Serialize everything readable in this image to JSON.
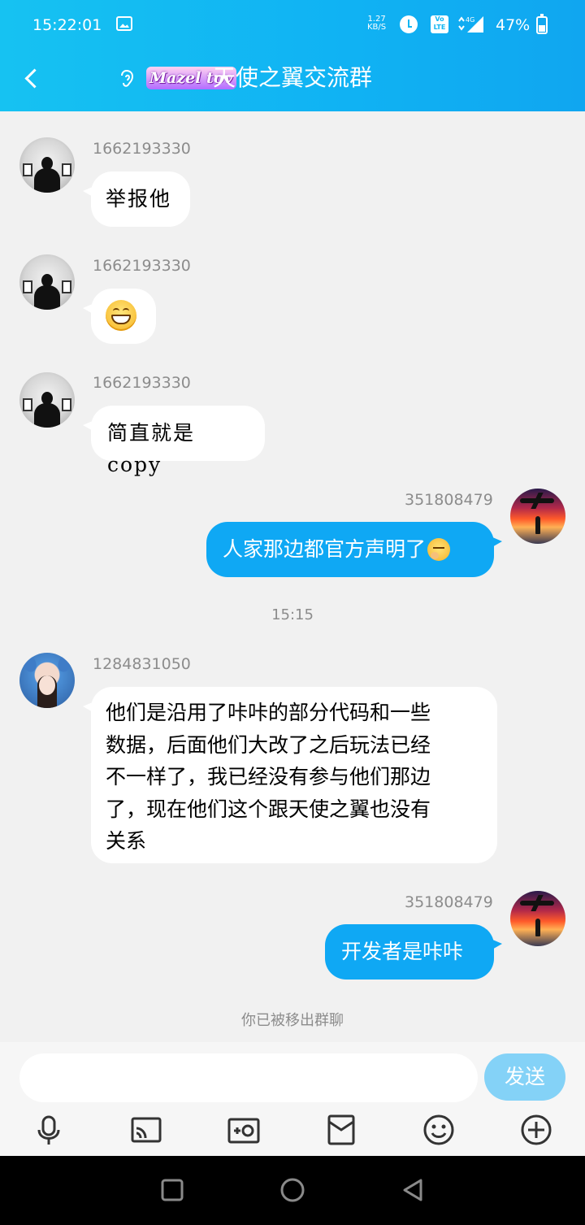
{
  "status_bar": {
    "time": "15:22:01",
    "net_speed_value": "1.27",
    "net_speed_unit": "KB/S",
    "volte_line1": "Vo",
    "volte_line2": "LTE",
    "network_type": "4G",
    "battery": "47%"
  },
  "header": {
    "mazel_text": "Mazel tov",
    "title": "天使之翼交流群"
  },
  "messages": [
    {
      "sender": "1662193330",
      "text": "举报他"
    },
    {
      "sender": "1662193330",
      "emoji": "grinning-face"
    },
    {
      "sender": "1662193330",
      "text": "简直就是copy"
    },
    {
      "sender": "351808479",
      "text": "人家那边都官方声明了",
      "emoji": "thinking-face"
    },
    {
      "timestamp": "15:15"
    },
    {
      "sender": "1284831050",
      "lines": [
        "他们是沿用了咔咔的部分代码和一些",
        "数据，后面他们大改了之后玩法已经",
        "不一样了，我已经没有参与他们那边",
        "了，现在他们这个跟天使之翼也没有",
        "关系"
      ]
    },
    {
      "sender": "351808479",
      "text": "开发者是咔咔"
    }
  ],
  "system_notice": "你已被移出群聊",
  "input": {
    "placeholder": "",
    "send_label": "发送"
  },
  "toolbar": [
    "microphone-icon",
    "cast-screen-icon",
    "video-camera-icon",
    "red-packet-icon",
    "smiley-icon",
    "add-circle-icon"
  ],
  "colors": {
    "header_start": "#16c2f2",
    "header_end": "#10a6f0",
    "self_bubble": "#0fa8f4",
    "send_button": "#84d2f7",
    "background": "#f1f1f1"
  }
}
